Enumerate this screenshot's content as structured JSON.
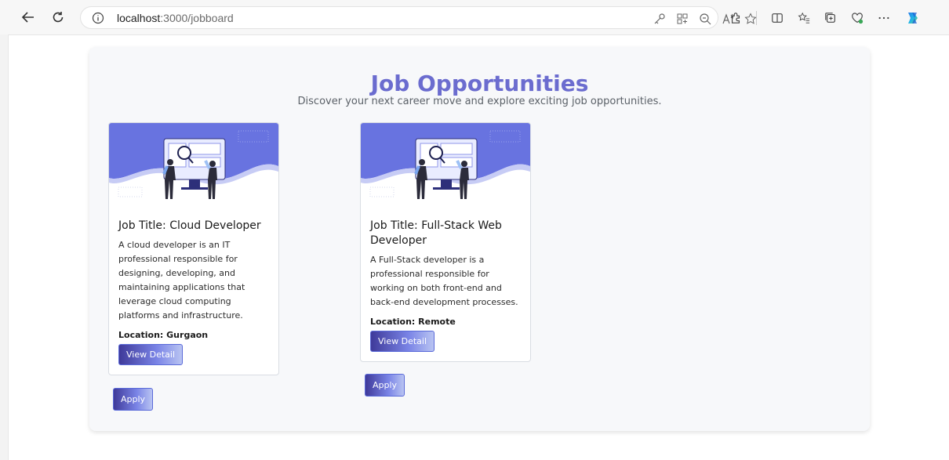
{
  "browser": {
    "url_host": "localhost",
    "url_path": ":3000/jobboard"
  },
  "page": {
    "title": "Job Opportunities",
    "subtitle": "Discover your next career move and explore exciting job opportunities."
  },
  "jobs": [
    {
      "title": "Job Title: Cloud Developer",
      "description": "A cloud developer is an IT professional responsible for designing, developing, and maintaining applications that leverage cloud computing platforms and infrastructure.",
      "location": "Location: Gurgaon",
      "detail_label": "View Detail",
      "apply_label": "Apply"
    },
    {
      "title": "Job Title: Full-Stack Web Developer",
      "description": "A Full-Stack developer is a professional responsible for working on both front-end and back-end development processes.",
      "location": "Location: Remote",
      "detail_label": "View Detail",
      "apply_label": "Apply"
    }
  ],
  "colors": {
    "accent": "#6b6ccf",
    "button_start": "#3f3a9a",
    "button_end": "#b9c4f2",
    "hero_wave": "#6873e0"
  }
}
